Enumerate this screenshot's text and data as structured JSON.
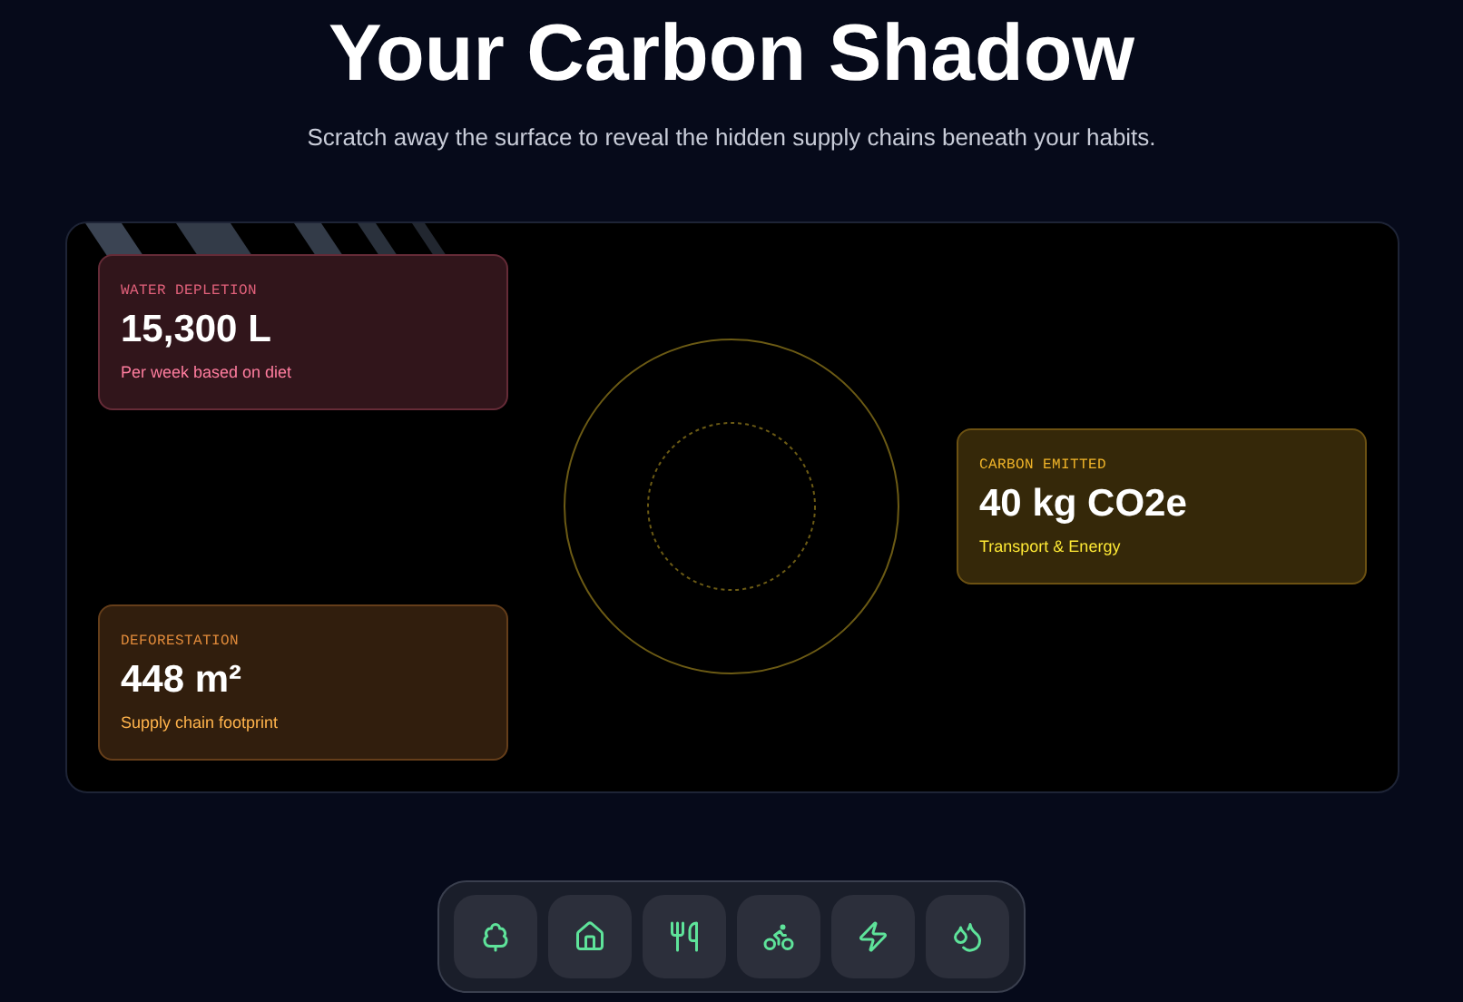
{
  "header": {
    "title": "Your Carbon Shadow",
    "subtitle": "Scratch away the surface to reveal the hidden supply chains beneath your habits."
  },
  "cards": [
    {
      "label": "WATER DEPLETION",
      "value": "15,300 L",
      "note": "Per week based on diet",
      "color": "#e0607a"
    },
    {
      "label": "CARBON EMITTED",
      "value": "40 kg CO2e",
      "note": "Transport & Energy",
      "color": "#f0b429"
    },
    {
      "label": "DEFORESTATION",
      "value": "448 m²",
      "note": "Supply chain footprint",
      "color": "#e08a3a"
    }
  ]
}
